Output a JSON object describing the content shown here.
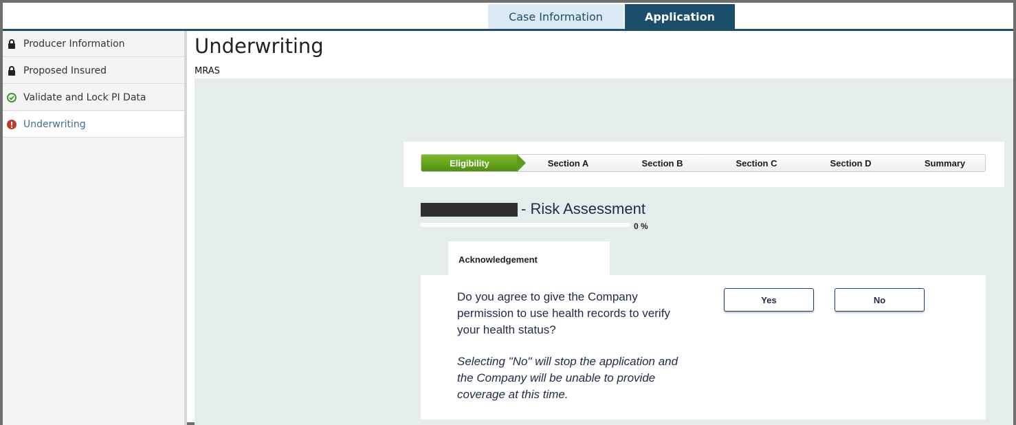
{
  "tabs": [
    {
      "label": "Case Information"
    },
    {
      "label": "Application",
      "active": true
    }
  ],
  "sidebar": {
    "items": [
      {
        "label": "Producer Information",
        "icon": "lock-icon"
      },
      {
        "label": "Proposed Insured",
        "icon": "lock-icon"
      },
      {
        "label": "Validate and Lock PI Data",
        "icon": "check-circle-icon"
      },
      {
        "label": "Underwriting",
        "icon": "alert-circle-icon",
        "active": true
      }
    ]
  },
  "page": {
    "title": "Underwriting",
    "subtitle": "MRAS"
  },
  "steps": {
    "items": [
      "Eligibility",
      "Section A",
      "Section B",
      "Section C",
      "Section D",
      "Summary"
    ],
    "active": "Eligibility"
  },
  "assessment": {
    "title": "- Risk Assessment",
    "progress_label": "0 %",
    "progress_value": 0
  },
  "acknowledgement": {
    "tab_label": "Acknowledgement",
    "question": "Do you agree to give the Company permission to use health records to verify your health status?",
    "note": "Selecting \"No\" will stop the application and the Company will be unable to provide coverage at this time.",
    "yes_label": "Yes",
    "no_label": "No"
  },
  "colors": {
    "accent": "#1c4e6b",
    "step_active": "#5e9c1a",
    "alert": "#c0392b",
    "ok": "#3c9a2a"
  }
}
